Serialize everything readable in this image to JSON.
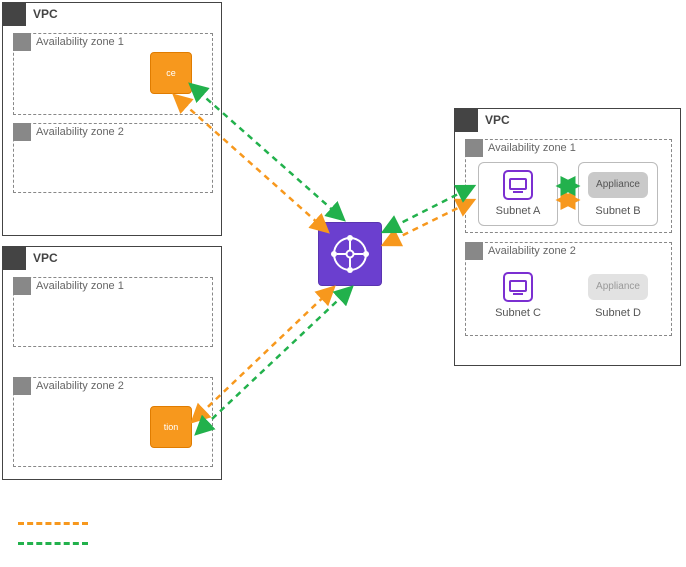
{
  "vpc_a": {
    "label": "VPC",
    "az1": {
      "label": "Availability zone 1",
      "instance_label": "ce"
    },
    "az2": {
      "label": "Availability zone 2"
    }
  },
  "vpc_b": {
    "label": "VPC",
    "az1": {
      "label": "Availability zone 1"
    },
    "az2": {
      "label": "Availability zone 2",
      "instance_label": "tion"
    }
  },
  "vpc_c": {
    "label": "VPC",
    "az1": {
      "label": "Availability zone 1",
      "subnet_a": {
        "caption": "Subnet A"
      },
      "subnet_b": {
        "caption": "Subnet B",
        "appliance_label": "Appliance"
      }
    },
    "az2": {
      "label": "Availability zone 2",
      "subnet_c": {
        "caption": "Subnet C"
      },
      "subnet_d": {
        "caption": "Subnet D",
        "appliance_label": "Appliance"
      }
    }
  },
  "colors": {
    "orange": "#f7981d",
    "green": "#22b14c",
    "purple": "#6b3fcf"
  }
}
